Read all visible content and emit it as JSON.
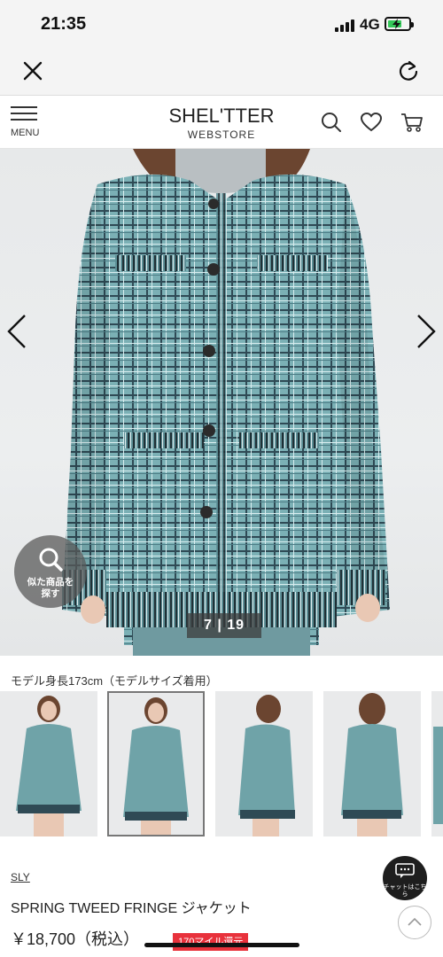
{
  "status_bar": {
    "time": "21:35",
    "network": "4G",
    "battery_color": "#35c759"
  },
  "browser": {
    "close_icon": "close-icon",
    "reload_icon": "reload-icon"
  },
  "header": {
    "menu_label": "MENU",
    "logo_main": "SHEL'TTER",
    "logo_sub": "WEBSTORE",
    "icons": [
      "search-icon",
      "heart-icon",
      "cart-icon"
    ]
  },
  "gallery": {
    "counter": "7 | 19",
    "current": 7,
    "total": 19,
    "similar_label": "似た商品を探す",
    "coat_color": "#6fa3a8"
  },
  "model_note": "モデル身長173cm（モデルサイズ着用）",
  "thumbnails": [
    {
      "selected": false,
      "view": "front"
    },
    {
      "selected": true,
      "view": "front"
    },
    {
      "selected": false,
      "view": "side"
    },
    {
      "selected": false,
      "view": "back"
    }
  ],
  "product": {
    "brand": "SLY",
    "name": "SPRING TWEED FRINGE ジャケット",
    "price": "￥18,700（税込）",
    "mile_badge": "170マイル還元",
    "mile_color": "#e8323c"
  },
  "chat": {
    "label": "チャットはこちら"
  }
}
